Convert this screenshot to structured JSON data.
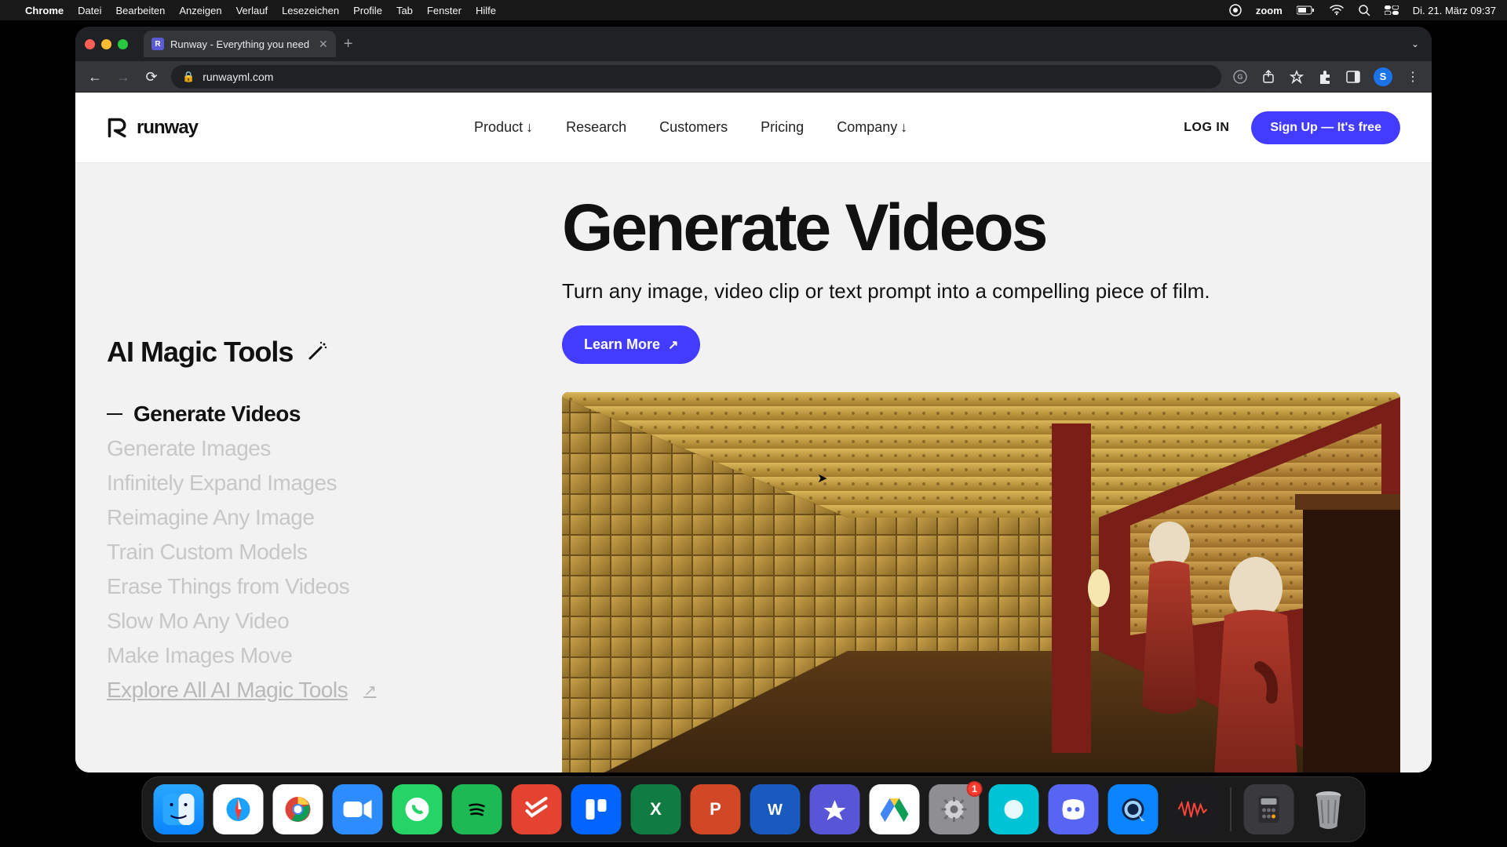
{
  "os_menubar": {
    "app_active": "Chrome",
    "items": [
      "Datei",
      "Bearbeiten",
      "Anzeigen",
      "Verlauf",
      "Lesezeichen",
      "Profile",
      "Tab",
      "Fenster",
      "Hilfe"
    ],
    "right": {
      "zoom_label": "zoom",
      "datetime": "Di. 21. März  09:37"
    }
  },
  "browser": {
    "tab_title": "Runway - Everything you need",
    "url": "runwayml.com",
    "avatar_initial": "S"
  },
  "header": {
    "logo_text": "runway",
    "nav": {
      "product": "Product",
      "research": "Research",
      "customers": "Customers",
      "pricing": "Pricing",
      "company": "Company"
    },
    "login": "LOG IN",
    "signup": "Sign Up — It's free"
  },
  "sidebar": {
    "heading": "AI Magic Tools",
    "items": [
      "Generate Videos",
      "Generate Images",
      "Infinitely Expand Images",
      "Reimagine Any Image",
      "Train Custom Models",
      "Erase Things from Videos",
      "Slow Mo Any Video",
      "Make Images Move"
    ],
    "explore": "Explore All AI Magic Tools"
  },
  "hero": {
    "title": "Generate Videos",
    "subtitle": "Turn any image, video clip or text prompt into a compelling piece of film.",
    "cta": "Learn More"
  },
  "dock": {
    "settings_badge": "1"
  }
}
